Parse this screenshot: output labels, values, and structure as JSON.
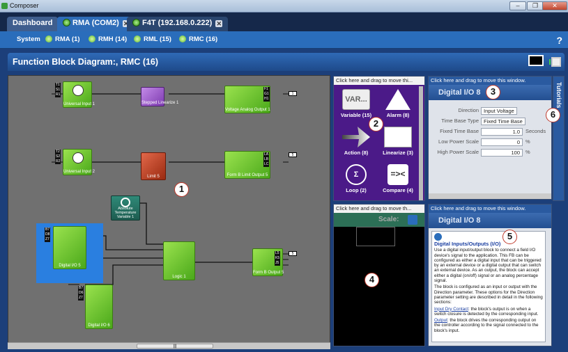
{
  "window": {
    "title": "Composer"
  },
  "tabs": [
    {
      "label": "Dashboard"
    },
    {
      "label": "RMA (COM2)"
    },
    {
      "label": "F4T (192.168.0.222)"
    }
  ],
  "subnav": {
    "items": [
      "System",
      "RMA (1)",
      "RMH (14)",
      "RML (15)",
      "RMC (16)"
    ]
  },
  "page": {
    "title": "Function Block Diagram:, RMC (16)"
  },
  "canvas": {
    "blocks": {
      "universal_input_1": "Universal Input 1",
      "linearize_1": "Stepped Linearize 1",
      "analog_output_1": "Voltage Analog Output 1",
      "universal_input_2": "Universal Input 2",
      "limit_5": "Limit 5",
      "limit_output_5": "Form B Limit Output 5",
      "abs_temp_1": "Absolute Temperature Variable 1",
      "digital_io_5": "Digital I/O 5",
      "logic_1": "Logic 1",
      "digital_io_6": "Digital I/O 6",
      "output_5": "Form B Output 5"
    }
  },
  "palette": {
    "drag_hint": "Click here and drag to move thi...",
    "items": [
      {
        "label": "Variable (15)"
      },
      {
        "label": "Alarm (8)"
      },
      {
        "label": "Action (8)"
      },
      {
        "label": "Linearize (3)"
      },
      {
        "label": "Loop (2)"
      },
      {
        "label": "Compare (4)"
      }
    ]
  },
  "scale_panel": {
    "drag_hint": "Click here and drag to move th...",
    "scale_label": "Scale:"
  },
  "properties": {
    "drag_hint": "Click here and drag to move this window.",
    "title": "Digital I/O 8",
    "direction_label": "Direction",
    "direction_value": "Input Voltage",
    "time_base_type_label": "Time Base Type",
    "time_base_type_value": "Fixed Time Base",
    "fixed_time_base_label": "Fixed Time Base",
    "fixed_time_base_value": "1.0",
    "fixed_time_base_unit": "Seconds",
    "low_power_label": "Low Power Scale",
    "low_power_value": "0",
    "low_power_unit": "%",
    "high_power_label": "High Power Scale",
    "high_power_value": "100",
    "high_power_unit": "%"
  },
  "help_panel": {
    "drag_hint": "Click here and drag to move this window.",
    "title": "Digital I/O 8",
    "heading": "Digital Inputs/Outputs (I/O)",
    "para1": "Use a digital input/output block to connect a field I/O device's signal to the application. This FB can be configured as either a digital input that can be triggered by an external device or a digital output that can switch an external device. As an output, the block can accept either a digital (on/off) signal or an analog percentage signal.",
    "para2": "The block is configured as an input or output with the Direction parameter. These options for the Direction parameter setting are described in detail in the following sections:",
    "link1": "Input Dry Contact",
    "link1_text": ": the block's output is on when a switch closure is detected by the corresponding input.",
    "link2": "Output",
    "link2_text": ": the block drives the corresponding output on the controller according to the signal connected to the block's input."
  },
  "side_tab": {
    "label": "Tutorials"
  },
  "callouts": [
    "1",
    "2",
    "3",
    "4",
    "5",
    "6"
  ]
}
